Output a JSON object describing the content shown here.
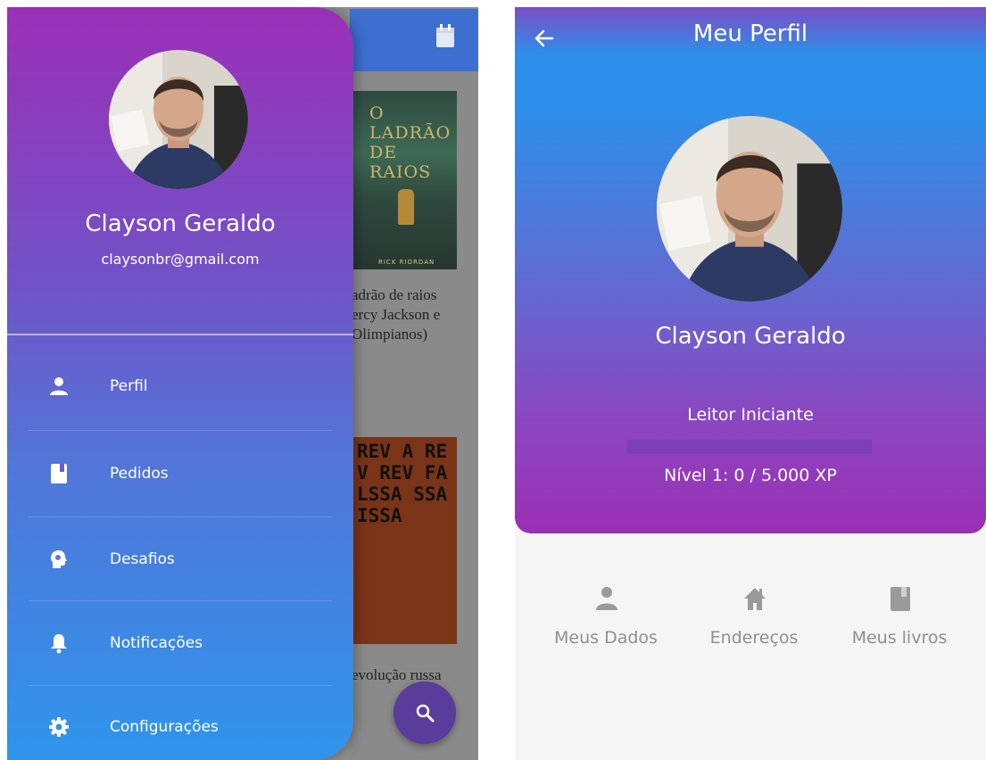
{
  "drawer": {
    "user_name": "Clayson Geraldo",
    "user_email": "claysonbr@gmail.com",
    "items": [
      {
        "label": "Perfil",
        "icon": "person-icon"
      },
      {
        "label": "Pedidos",
        "icon": "book-icon"
      },
      {
        "label": "Desafios",
        "icon": "brain-icon"
      },
      {
        "label": "Notificações",
        "icon": "bell-icon"
      },
      {
        "label": "Configurações",
        "icon": "gear-icon"
      }
    ]
  },
  "background": {
    "book1_title": "O LADRÃO DE RAIOS",
    "book1_author": "RICK RIORDAN",
    "book1_caption": "adrão de raios\nercy Jackson e\nOlimpianos)",
    "book2_cover_text": "REV A REV REV FA LSSA SSA ISSA",
    "book2_caption": "evolução russa"
  },
  "profile": {
    "title": "Meu Perfil",
    "user_name": "Clayson Geraldo",
    "level_name": "Leitor Iniciante",
    "xp_progress": 0,
    "xp_text": "Nível 1: 0 / 5.000 XP",
    "tabs": [
      {
        "label": "Meus Dados",
        "icon": "person-icon"
      },
      {
        "label": "Endereços",
        "icon": "home-icon"
      },
      {
        "label": "Meus livros",
        "icon": "book-icon"
      }
    ]
  },
  "colors": {
    "accent_purple": "#9b2fb8",
    "accent_blue": "#2f95ec",
    "tab_grey": "#8f8f8f"
  }
}
